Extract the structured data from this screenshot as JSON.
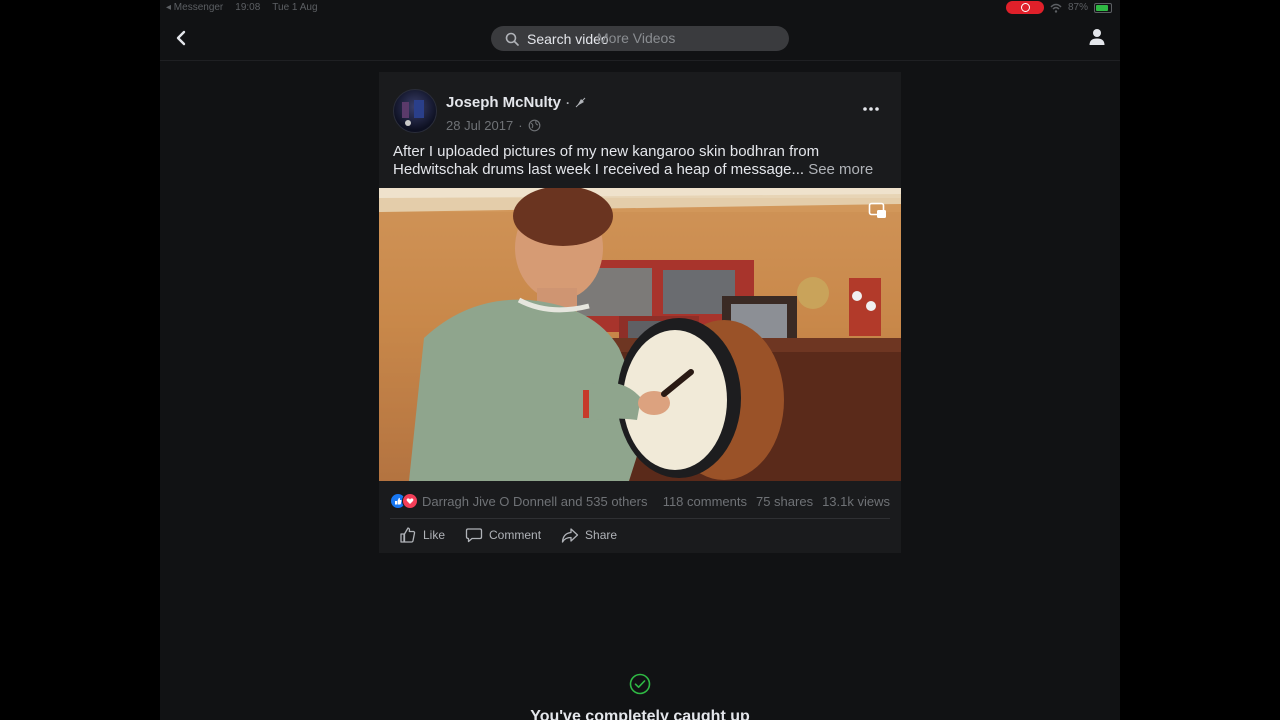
{
  "status_bar": {
    "back_app": "◂ Messenger",
    "time": "19:08",
    "date": "Tue 1 Aug",
    "battery": "87%",
    "battery_level": 0.87
  },
  "search": {
    "placeholder": "Search video",
    "ghost_text": "More Videos"
  },
  "post": {
    "author": "Joseph McNulty",
    "date": "28 Jul 2017",
    "text": "After I uploaded pictures of my new kangaroo skin bodhran from Hedwitschak drums last week I received a heap of message...",
    "see_more": "See more",
    "reactions_text": "Darragh Jive O Donnell and 535 others",
    "comments": "118 comments",
    "shares": "75 shares",
    "views": "13.1k views"
  },
  "actions": {
    "like": "Like",
    "comment": "Comment",
    "share": "Share"
  },
  "feed_end": {
    "caught_up": "You've completely caught up"
  },
  "colors": {
    "accent_like": "#1877f2",
    "accent_love": "#f33e58",
    "check_green": "#2fb944"
  }
}
